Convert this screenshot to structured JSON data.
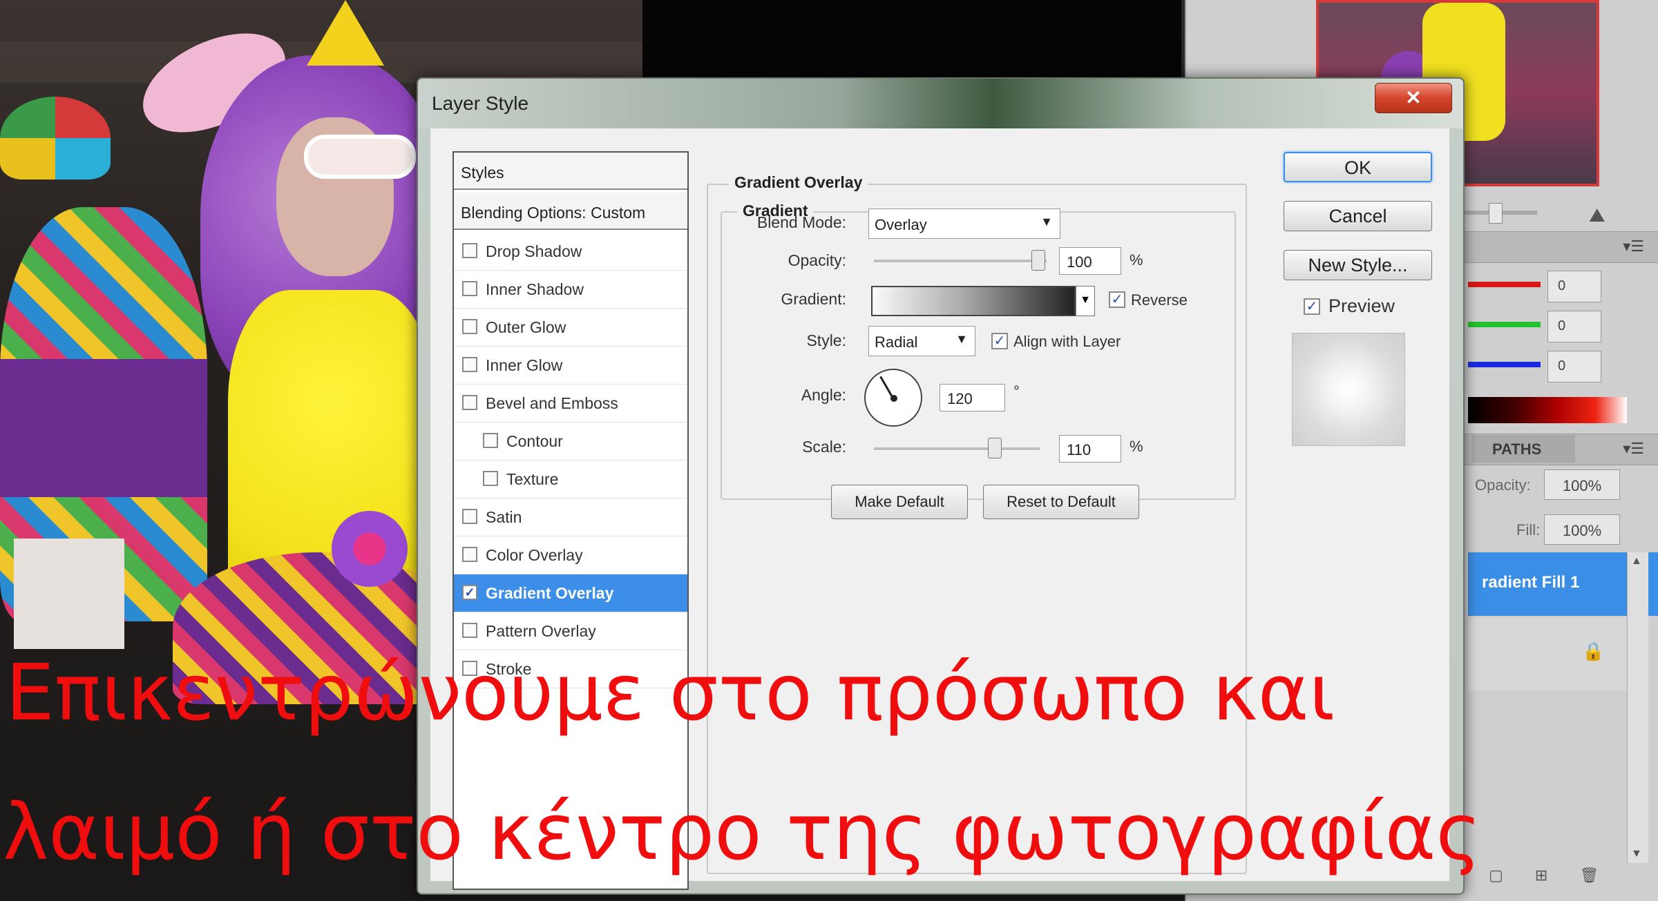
{
  "dialog": {
    "title": "Layer Style",
    "close_label": "✕"
  },
  "styles_list": {
    "header": "Styles",
    "blending": "Blending Options: Custom",
    "items": [
      {
        "label": "Drop Shadow",
        "checked": false,
        "indent": false
      },
      {
        "label": "Inner Shadow",
        "checked": false,
        "indent": false
      },
      {
        "label": "Outer Glow",
        "checked": false,
        "indent": false
      },
      {
        "label": "Inner Glow",
        "checked": false,
        "indent": false
      },
      {
        "label": "Bevel and Emboss",
        "checked": false,
        "indent": false
      },
      {
        "label": "Contour",
        "checked": false,
        "indent": true
      },
      {
        "label": "Texture",
        "checked": false,
        "indent": true
      },
      {
        "label": "Satin",
        "checked": false,
        "indent": false
      },
      {
        "label": "Color Overlay",
        "checked": false,
        "indent": false
      },
      {
        "label": "Gradient Overlay",
        "checked": true,
        "indent": false
      },
      {
        "label": "Pattern Overlay",
        "checked": false,
        "indent": false
      },
      {
        "label": "Stroke",
        "checked": false,
        "indent": false
      }
    ]
  },
  "gradient_overlay": {
    "group_title": "Gradient Overlay",
    "inner_title": "Gradient",
    "blend_mode_label": "Blend Mode:",
    "blend_mode": "Overlay",
    "opacity_label": "Opacity:",
    "opacity": "100",
    "opacity_unit": "%",
    "opacity_fraction": 1.0,
    "gradient_label": "Gradient:",
    "reverse_label": "Reverse",
    "style_label": "Style:",
    "style": "Radial",
    "align_label": "Align with Layer",
    "angle_label": "Angle:",
    "angle": "120",
    "angle_unit": "°",
    "scale_label": "Scale:",
    "scale": "110",
    "scale_unit": "%",
    "scale_fraction": 0.73,
    "make_default": "Make Default",
    "reset_default": "Reset to Default"
  },
  "buttons": {
    "ok": "OK",
    "cancel": "Cancel",
    "new_style": "New Style...",
    "preview_label": "Preview"
  },
  "right_panels": {
    "color_values": [
      "0",
      "0",
      "0"
    ],
    "paths_tab": "PATHS",
    "opacity_label": "Opacity:",
    "opacity": "100%",
    "fill_label": "Fill:",
    "fill": "100%",
    "layer_name": "radient Fill 1"
  },
  "subtitles": {
    "line1": "Επικεντρώνουμε στο πρόσωπο και",
    "line2": "λαιμό ή στο κέντρο της φωτογραφίας"
  },
  "colors": {
    "subtitle": "#f00d0d",
    "selection": "#3c8ee8",
    "close_button": "#d4452c"
  }
}
